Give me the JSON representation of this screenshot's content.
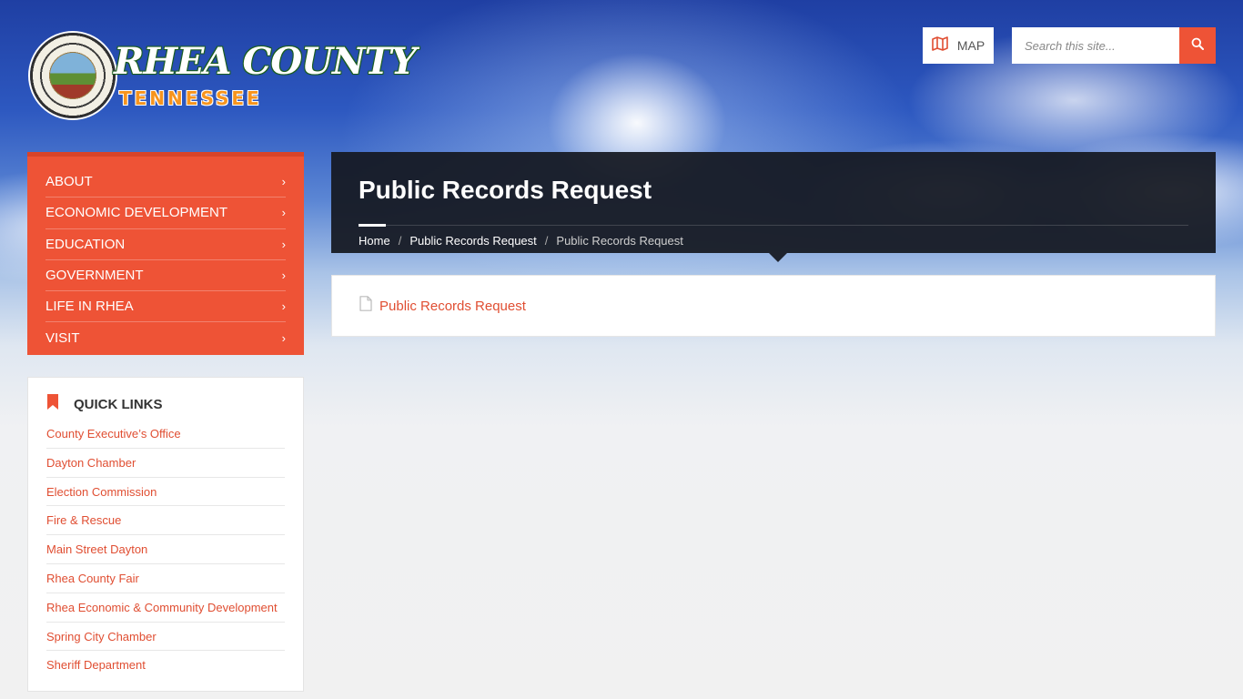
{
  "header": {
    "logo": {
      "name": "RHEA COUNTY",
      "state": "TENNESSEE"
    },
    "map_label": "MAP",
    "search_placeholder": "Search this site...",
    "search_value": ""
  },
  "nav": {
    "items": [
      {
        "label": "ABOUT"
      },
      {
        "label": "ECONOMIC DEVELOPMENT"
      },
      {
        "label": "EDUCATION"
      },
      {
        "label": "GOVERNMENT"
      },
      {
        "label": "LIFE IN RHEA"
      },
      {
        "label": "VISIT"
      }
    ]
  },
  "quick_links": {
    "title": "QUICK LINKS",
    "items": [
      {
        "label": "County Executive’s Office"
      },
      {
        "label": "Dayton Chamber"
      },
      {
        "label": "Election Commission"
      },
      {
        "label": "Fire & Rescue"
      },
      {
        "label": "Main Street Dayton"
      },
      {
        "label": "Rhea County Fair"
      },
      {
        "label": "Rhea Economic & Community Development"
      },
      {
        "label": "Spring City Chamber"
      },
      {
        "label": "Sheriff Department"
      }
    ]
  },
  "page": {
    "title": "Public Records Request",
    "breadcrumb": {
      "home": "Home",
      "parent": "Public Records Request",
      "current": "Public Records Request",
      "separator": "/"
    },
    "document_link": "Public Records Request"
  },
  "colors": {
    "accent": "#ee5336",
    "link": "#e04e32",
    "header_dark": "#14181f"
  },
  "icons": {
    "map": "map-icon",
    "search": "search-icon",
    "chevron": "chevron-right-icon",
    "bookmark": "bookmark-icon",
    "document": "document-icon"
  }
}
